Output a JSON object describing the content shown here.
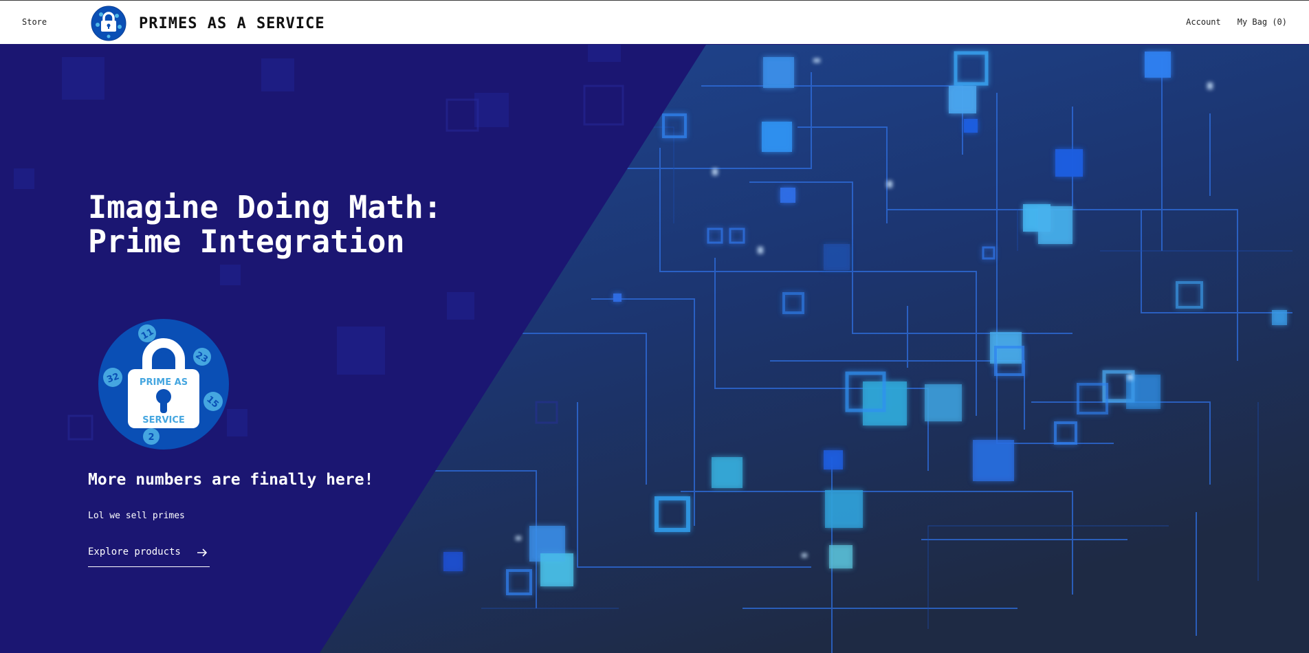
{
  "header": {
    "nav_store": "Store",
    "brand_title": "PRIMES AS A SERVICE",
    "nav_account": "Account",
    "nav_bag": "My Bag (0)"
  },
  "hero": {
    "headline": "Imagine Doing Math:\nPrime Integration",
    "subhead": "More numbers are finally here!",
    "tagline": "Lol we sell primes",
    "cta_label": "Explore products",
    "logo": {
      "top_text": "PRIME AS",
      "bottom_text": "SERVICE",
      "numbers": [
        "11",
        "23",
        "32",
        "15",
        "2"
      ]
    }
  },
  "colors": {
    "hero_dark": "#1b1672",
    "circuit_bg": "#1c3a78",
    "accent_blue": "#0a4fb5",
    "light_blue": "#4fb8e8"
  },
  "icons": {
    "brand": "padlock-logo-icon",
    "cta": "arrow-right-icon"
  }
}
